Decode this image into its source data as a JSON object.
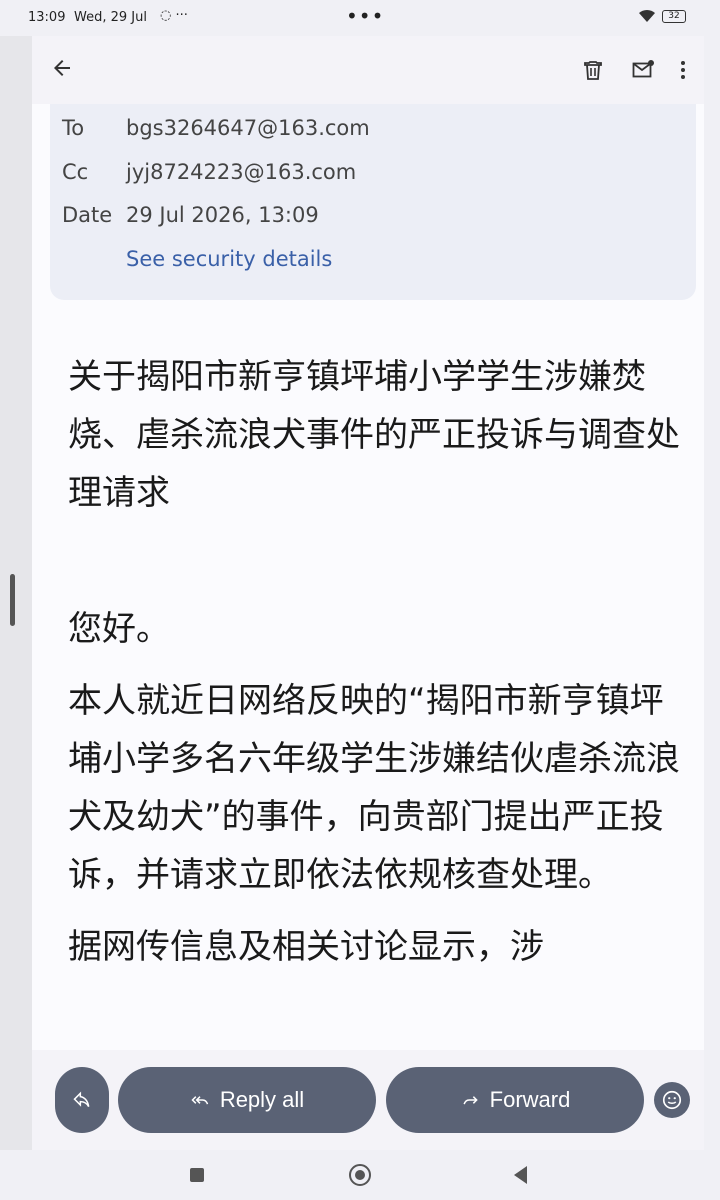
{
  "status_bar": {
    "time": "13:09",
    "date": "Wed, 29 Jul",
    "notification_icons": "◌ ···",
    "center_dots": "•••",
    "battery": "32"
  },
  "header": {
    "back_icon": "arrow-left-icon",
    "delete_icon": "trash-icon",
    "mark_unread_icon": "mail-unread-icon",
    "more_icon": "more-vert-icon"
  },
  "details": {
    "to_label": "To",
    "to_value": "bgs3264647@163.com",
    "cc_label": "Cc",
    "cc_value": "jyj8724223@163.com",
    "date_label": "Date",
    "date_value": "29 Jul 2026, 13:09",
    "security_link": "See security details"
  },
  "body": {
    "subject": "关于揭阳市新亨镇坪埔小学学生涉嫌焚烧、虐杀流浪犬事件的严正投诉与调查处理请求",
    "greeting": "您好。",
    "paragraph1": "本人就近日网络反映的“揭阳市新亨镇坪埔小学多名六年级学生涉嫌结伙虐杀流浪犬及幼犬”的事件，向贵部门提出严正投诉，并请求立即依法依规核查处理。",
    "paragraph2": "据网传信息及相关讨论显示，涉"
  },
  "actions": {
    "reply_icon": "reply-icon",
    "reply_all_label": "Reply all",
    "forward_label": "Forward",
    "emoji_icon": "emoji-icon"
  },
  "colors": {
    "pill_bg": "#5a6275",
    "link": "#3a60a8",
    "card_bg": "#eceef6"
  }
}
